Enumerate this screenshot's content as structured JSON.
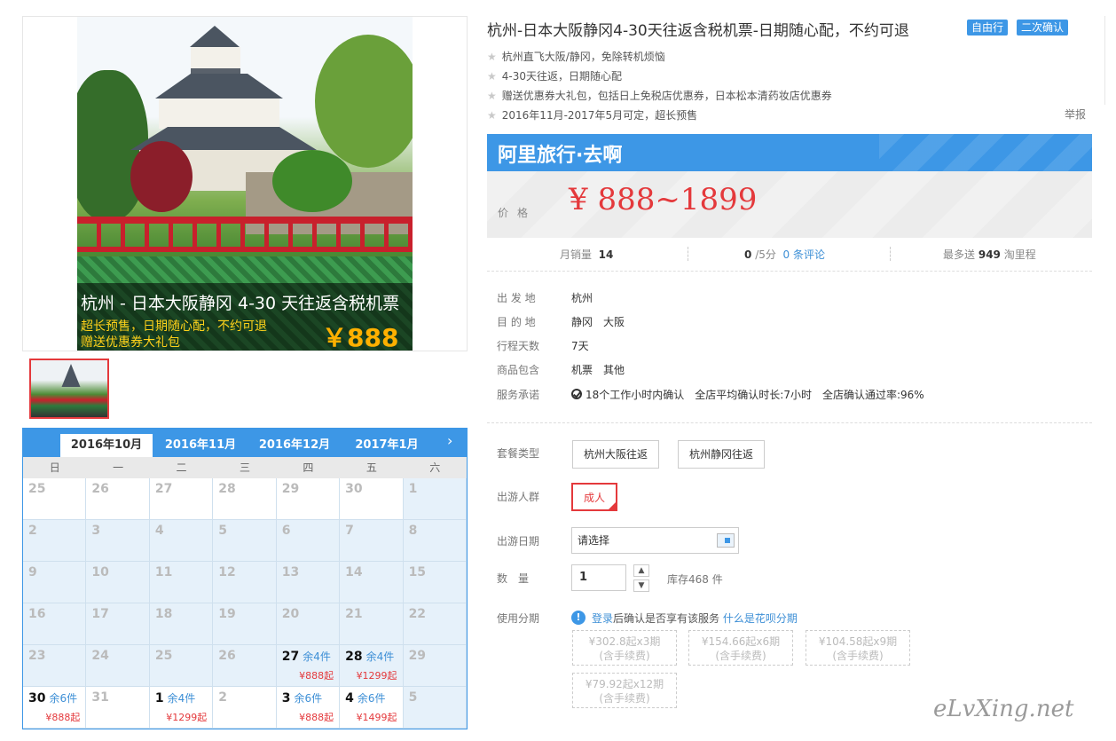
{
  "gallery": {
    "overlay_title": "杭州 - 日本大阪静冈 4-30 天往返含税机票",
    "overlay_sub1": "超长预售，日期随心配，不约可退",
    "overlay_sub2": "赠送优惠券大礼包",
    "overlay_price": "￥888"
  },
  "calendar": {
    "tabs": [
      "2016年10月",
      "2016年11月",
      "2016年12月",
      "2017年1月"
    ],
    "active_tab": 0,
    "next": "›",
    "weekdays": [
      "日",
      "一",
      "二",
      "三",
      "四",
      "五",
      "六"
    ],
    "cells": [
      {
        "d": "25"
      },
      {
        "d": "26"
      },
      {
        "d": "27"
      },
      {
        "d": "28"
      },
      {
        "d": "29"
      },
      {
        "d": "30"
      },
      {
        "d": "1"
      },
      {
        "d": "2"
      },
      {
        "d": "3"
      },
      {
        "d": "4"
      },
      {
        "d": "5"
      },
      {
        "d": "6"
      },
      {
        "d": "7"
      },
      {
        "d": "8"
      },
      {
        "d": "9"
      },
      {
        "d": "10"
      },
      {
        "d": "11"
      },
      {
        "d": "12"
      },
      {
        "d": "13"
      },
      {
        "d": "14"
      },
      {
        "d": "15"
      },
      {
        "d": "16"
      },
      {
        "d": "17"
      },
      {
        "d": "18"
      },
      {
        "d": "19"
      },
      {
        "d": "20"
      },
      {
        "d": "21"
      },
      {
        "d": "22"
      },
      {
        "d": "23"
      },
      {
        "d": "24"
      },
      {
        "d": "25"
      },
      {
        "d": "26"
      },
      {
        "d": "27",
        "left": "余4件",
        "price": "¥888起"
      },
      {
        "d": "28",
        "left": "余4件",
        "price": "¥1299起"
      },
      {
        "d": "29"
      },
      {
        "d": "30",
        "left": "余6件",
        "price": "¥888起"
      },
      {
        "d": "31"
      },
      {
        "d": "1",
        "left": "余4件",
        "price": "¥1299起"
      },
      {
        "d": "2"
      },
      {
        "d": "3",
        "left": "余6件",
        "price": "¥888起"
      },
      {
        "d": "4",
        "left": "余6件",
        "price": "¥1499起"
      },
      {
        "d": "5"
      }
    ]
  },
  "product": {
    "title": "杭州-日本大阪静冈4-30天往返含税机票-日期随心配，不约可退",
    "tags": [
      "自由行",
      "二次确认"
    ],
    "features": [
      "杭州直飞大阪/静冈，免除转机烦恼",
      "4-30天往返，日期随心配",
      "赠送优惠券大礼包，包括日上免税店优惠券，日本松本清药妆店优惠券",
      "2016年11月-2017年5月可定，超长预售"
    ],
    "report": "举报",
    "brand": "阿里旅行·去啊",
    "price_label": "价格",
    "price": "¥ 888~1899"
  },
  "stats": {
    "monthly_label": "月销量",
    "monthly_value": "14",
    "score_value": "0",
    "score_suffix": "/5分",
    "reviews": "0 条评论",
    "mileage_prefix": "最多送",
    "mileage_value": "949",
    "mileage_suffix": "淘里程"
  },
  "info": [
    {
      "k": "出 发 地",
      "v": "杭州"
    },
    {
      "k": "目 的 地",
      "v": "静冈　大阪"
    },
    {
      "k": "行程天数",
      "v": "7天"
    },
    {
      "k": "商品包含",
      "v": "机票　其他"
    },
    {
      "k": "服务承诺",
      "v": "18个工作小时内确认　全店平均确认时长:7小时　全店确认通过率:96%"
    }
  ],
  "options": {
    "package_label": "套餐类型",
    "packages": [
      "杭州大阪往返",
      "杭州静冈往返"
    ],
    "people_label": "出游人群",
    "people": "成人",
    "date_label": "出游日期",
    "date_value": "请选择",
    "qty_label": "数　量",
    "qty_value": "1",
    "stock": "库存468 件",
    "installment_label": "使用分期",
    "installment_login": "登录",
    "installment_text": "后确认是否享有该服务",
    "installment_link": "什么是花呗分期",
    "plans": [
      {
        "line1": "¥302.8起x3期",
        "line2": "(含手续费)"
      },
      {
        "line1": "¥154.66起x6期",
        "line2": "(含手续费)"
      },
      {
        "line1": "¥104.58起x9期",
        "line2": "(含手续费)"
      },
      {
        "line1": "¥79.92起x12期",
        "line2": "(含手续费)"
      }
    ]
  },
  "watermark": "eLvXing.net",
  "colors": {
    "accent": "#3d97e6",
    "price": "#e4393c"
  }
}
